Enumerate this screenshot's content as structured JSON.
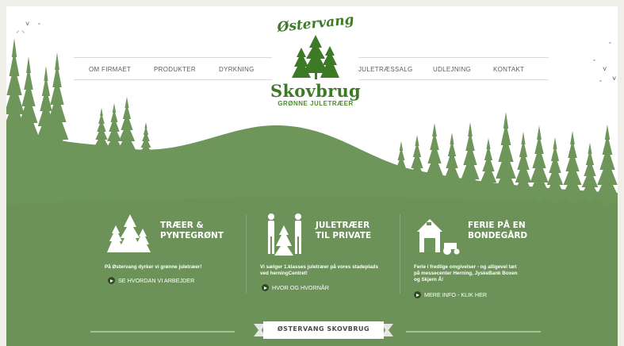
{
  "nav": {
    "left": [
      "OM FIRMAET",
      "PRODUKTER",
      "DYRKNING"
    ],
    "right": [
      "JULETRÆSSALG",
      "UDLEJNING",
      "KONTAKT"
    ]
  },
  "logo": {
    "top": "Østervang",
    "main": "Skovbrug",
    "sub": "GRØNNE JULETRÆER"
  },
  "cards": [
    {
      "title_line1": "TRÆER &",
      "title_line2": "PYNTEGRØNT",
      "text": "På Østervang dyrker vi grønne juletræer!",
      "link": "SE HVORDAN VI ARBEJDER",
      "icon": "trees-icon"
    },
    {
      "title_line1": "JULETRÆER",
      "title_line2": "TIL PRIVATE",
      "text": "Vi sælger 1.klasses juletræer på vores stadeplads ved herningCentret!",
      "link": "HVOR OG HVORNÅR",
      "icon": "people-with-tree-icon"
    },
    {
      "title_line1": "FERIE PÅ EN",
      "title_line2": "BONDEGÅRD",
      "text": "Ferie i fredlige omgivelser - og alligevel tæt på messecenter Herning, JyskeBank Boxen og Skjern Å!",
      "link": "MERE INFO - KLIK HER",
      "icon": "farmhouse-icon"
    }
  ],
  "footer": {
    "banner": "ØSTERVANG SKOVBRUG"
  },
  "colors": {
    "green": "#6e955a",
    "green_dark": "#5f8a4b",
    "logo_green": "#3d7a25",
    "page_bg": "#ffffff"
  }
}
